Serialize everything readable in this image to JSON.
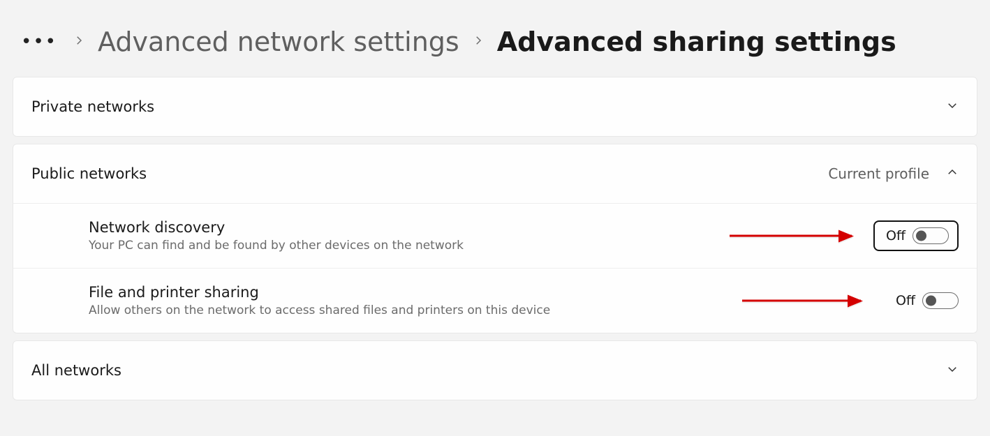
{
  "breadcrumb": {
    "dots": "•••",
    "parent": "Advanced network settings",
    "current": "Advanced sharing settings"
  },
  "sections": {
    "private": {
      "title": "Private networks"
    },
    "public": {
      "title": "Public networks",
      "badge": "Current profile",
      "network_discovery": {
        "label": "Network discovery",
        "desc": "Your PC can find and be found by other devices on the network",
        "state": "Off"
      },
      "file_printer": {
        "label": "File and printer sharing",
        "desc": "Allow others on the network to access shared files and printers on this device",
        "state": "Off"
      }
    },
    "all": {
      "title": "All networks"
    }
  }
}
